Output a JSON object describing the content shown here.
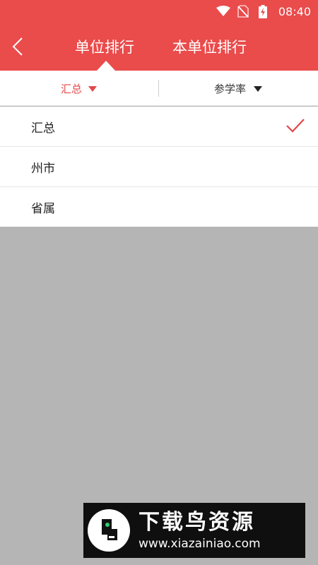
{
  "status_bar": {
    "time": "08:40",
    "icons": [
      "wifi-icon",
      "no-sim-icon",
      "battery-charging-icon"
    ]
  },
  "header": {
    "back_icon": "chevron-left-icon",
    "tabs": [
      {
        "label": "单位排行",
        "active": true
      },
      {
        "label": "本单位排行",
        "active": false
      }
    ],
    "background_color": "#ea4b4b"
  },
  "filters": {
    "summary": {
      "label": "汇总",
      "active": true,
      "icon": "triangle-down-icon"
    },
    "rate": {
      "label": "参学率",
      "active": false,
      "icon": "triangle-down-icon"
    },
    "active_color": "#e34848"
  },
  "dropdown": {
    "options": [
      {
        "label": "汇总",
        "selected": true
      },
      {
        "label": "州市",
        "selected": false
      },
      {
        "label": "省属",
        "selected": false
      }
    ],
    "selected_icon": "check-icon"
  },
  "overlay_color": "#b5b5b5",
  "watermark": {
    "brand": "下载鸟资源",
    "url": "www.xiazainiao.com",
    "logo_glyph": "鸟"
  }
}
